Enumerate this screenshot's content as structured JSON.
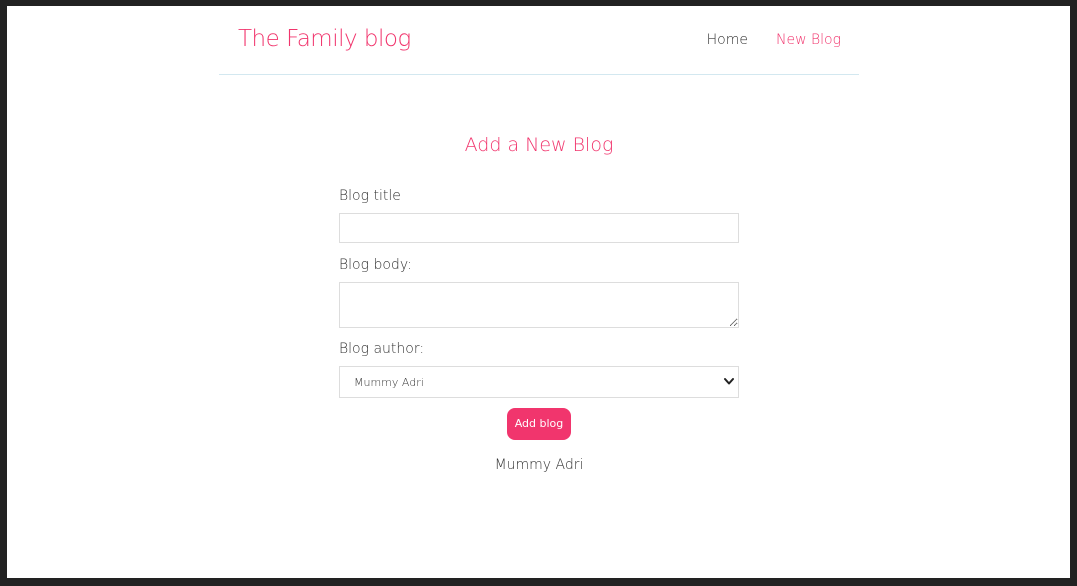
{
  "navbar": {
    "brand": "The Family blog",
    "links": [
      {
        "label": "Home",
        "active": false
      },
      {
        "label": "New Blog",
        "active": true
      }
    ]
  },
  "form": {
    "heading": "Add a New Blog",
    "title_label": "Blog title",
    "title_value": "",
    "body_label": "Blog body:",
    "body_value": "",
    "author_label": "Blog author:",
    "author_selected": "Mummy Adri",
    "submit_label": "Add blog"
  },
  "preview": {
    "author": "Mummy Adri"
  },
  "colors": {
    "accent": "#f1356d",
    "text": "#333333",
    "divider": "#d3e8f0"
  }
}
